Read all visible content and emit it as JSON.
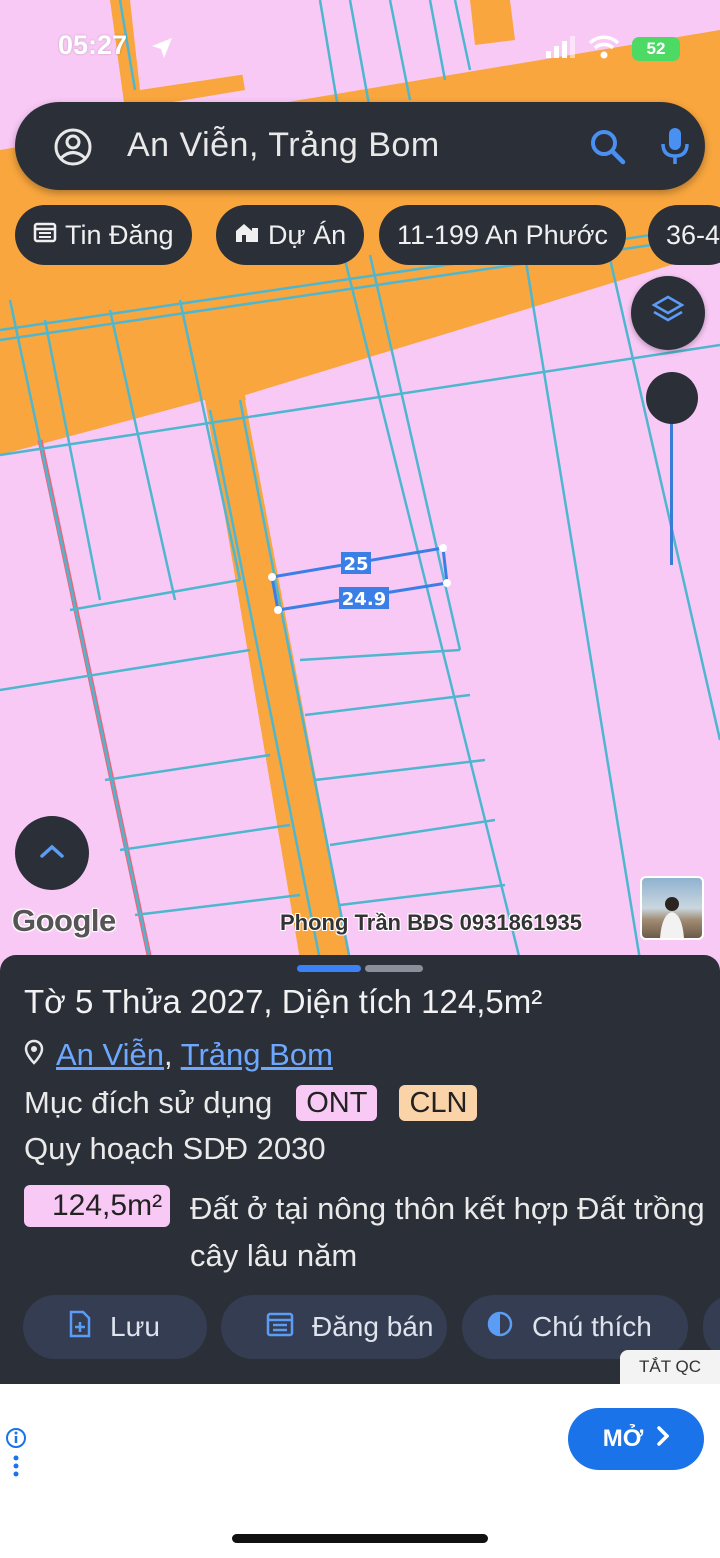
{
  "status_bar": {
    "time": "05:27",
    "battery": "52"
  },
  "search": {
    "query": "An Viễn, Trảng Bom"
  },
  "chips": [
    {
      "label": "Tin Đăng",
      "icon": "calendar-icon"
    },
    {
      "label": "Dự Án",
      "icon": "building-icon"
    },
    {
      "label": "11-199 An Phước",
      "icon": ""
    },
    {
      "label": "36-4",
      "icon": ""
    }
  ],
  "map": {
    "logo": "Google",
    "watermark": "Phong Trần BĐS 0931861935",
    "dimension_top": "25",
    "dimension_bottom": "24.9",
    "colors": {
      "residential": "#f9c9f6",
      "road": "#f9a63e",
      "parcel_line": "#4fb6cf",
      "selection": "#3b7ee6"
    }
  },
  "sheet": {
    "title": "Tờ 5 Thửa 2027, Diện tích 124,5m²",
    "location": {
      "commune": "An Viễn",
      "district": "Trảng Bom",
      "separator": ","
    },
    "purpose_label": "Mục đích sử dụng",
    "purpose_badges": [
      {
        "code": "ONT",
        "color": "#f9c9f6"
      },
      {
        "code": "CLN",
        "color": "#fbd3a8"
      }
    ],
    "planning_label": "Quy hoạch SDĐ 2030",
    "planning_area": "124,5m²",
    "planning_desc": "Đất ở tại nông thôn kết hợp Đất trồng cây lâu năm",
    "actions": [
      {
        "label": "Lưu",
        "icon": "file-plus-icon"
      },
      {
        "label": "Đăng bán",
        "icon": "calendar-list-icon"
      },
      {
        "label": "Chú thích",
        "icon": "contrast-icon"
      }
    ]
  },
  "ad": {
    "close_label": "TẮT QC",
    "open_label": "MỞ"
  }
}
